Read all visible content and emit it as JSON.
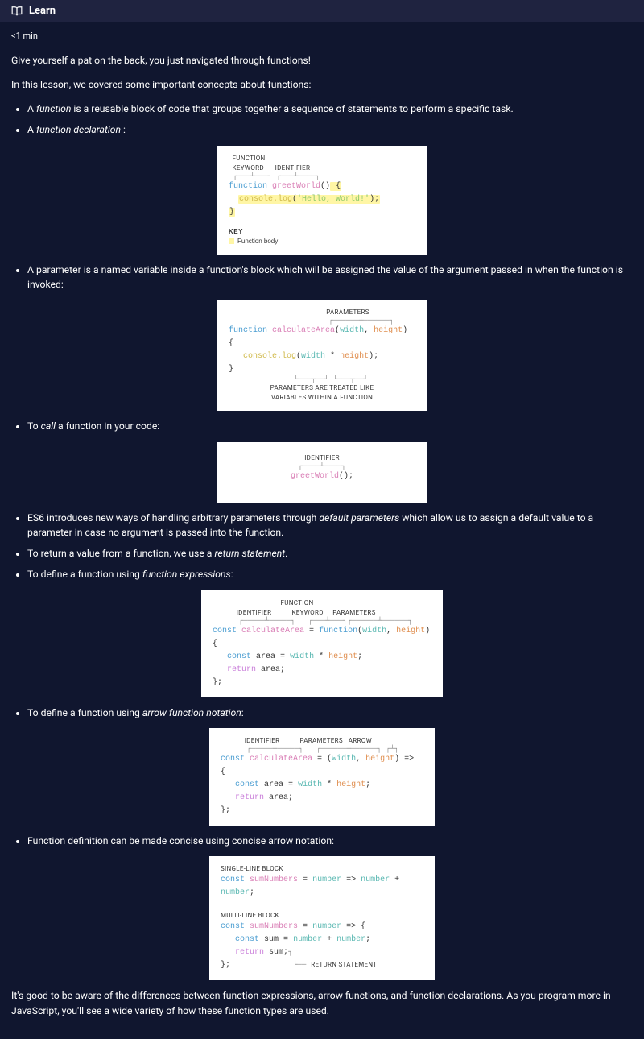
{
  "header": {
    "title": "Learn"
  },
  "readtime": "<1 min",
  "intro_line": "Give yourself a pat on the back, you just navigated through functions!",
  "intro_sub": "In this lesson, we covered some important concepts about functions:",
  "bullets": {
    "b1a": "A ",
    "b1i": "function",
    "b1b": " is a reusable block of code that groups together a sequence of statements to perform a specific task.",
    "b2a": "A ",
    "b2i": "function declaration",
    "b2b": " :",
    "b3": "A parameter is a named variable inside a function's block which will be assigned the value of the argument passed in when the function is invoked:",
    "b4a": "To ",
    "b4i": "call",
    "b4b": " a function in your code:",
    "b5a": "ES6 introduces new ways of handling arbitrary parameters through ",
    "b5i": "default parameters",
    "b5b": " which allow us to assign a default value to a parameter in case no argument is passed into the function.",
    "b6a": "To return a value from a function, we use a ",
    "b6i": "return statement",
    "b6b": ".",
    "b7a": "To define a function using ",
    "b7i": "function expressions",
    "b7b": ":",
    "b8a": "To define a function using ",
    "b8i": "arrow function notation",
    "b8b": ":",
    "b9": "Function definition can be made concise using concise arrow notation:"
  },
  "outro": "It's good to be aware of the differences between function expressions, arrow functions, and function declarations. As you program more in JavaScript, you'll see a wide variety of how these function types are used.",
  "diagram1": {
    "lbl_func": "FUNCTION",
    "lbl_kw": "KEYWORD",
    "lbl_id": "IDENTIFIER",
    "code_kw": "function",
    "code_id": "greetWorld",
    "code_par": "()",
    "code_brace_open": " {",
    "code_log": "console.log",
    "code_paren_open": "(",
    "code_str": "'Hello, World!'",
    "code_paren_close": ")",
    "code_semi": ";",
    "code_brace_close": "}",
    "key_title": "KEY",
    "key_item": "Function body"
  },
  "diagram2": {
    "lbl_params": "PARAMETERS",
    "code_kw": "function",
    "code_id": "calculateArea",
    "code_paren_open": "(",
    "p1": "width",
    "comma": ", ",
    "p2": "height",
    "code_paren_close": ")",
    "brace_open": " {",
    "code_log": "console.log",
    "star": " * ",
    "brace_close": "}",
    "lbl_bottom1": "PARAMETERS ARE TREATED LIKE",
    "lbl_bottom2": "VARIABLES WITHIN A FUNCTION"
  },
  "diagram3": {
    "lbl_id": "IDENTIFIER",
    "code_id": "greetWorld",
    "code_call": "();"
  },
  "diagram4": {
    "lbl_id": "IDENTIFIER",
    "lbl_func": "FUNCTION",
    "lbl_kw": "KEYWORD",
    "lbl_params": "PARAMETERS",
    "code_const": "const",
    "code_id": "calculateArea",
    "code_eq": " = ",
    "code_kw": "function",
    "paren_open": "(",
    "p1": "width",
    "comma": ", ",
    "p2": "height",
    "paren_close": ")",
    "brace_open": " {",
    "line2a": "const",
    "line2b": " area ",
    "line2c": "= ",
    "line2d": "width",
    "star": " * ",
    "line2e": "height",
    "semi": ";",
    "ret": "return",
    "retval": " area",
    "brace_close": "};"
  },
  "diagram5": {
    "lbl_id": "IDENTIFIER",
    "lbl_params": "PARAMETERS",
    "lbl_arrow": "ARROW",
    "code_const": "const",
    "code_id": "calculateArea",
    "code_eq": " = ",
    "paren_open": "(",
    "p1": "width",
    "comma": ", ",
    "p2": "height",
    "paren_close": ")",
    "arrow": " => ",
    "brace_open": "{",
    "line2a": "const",
    "line2b": " area ",
    "line2c": "= ",
    "line2d": "width",
    "star": " * ",
    "line2e": "height",
    "semi": ";",
    "ret": "return",
    "retval": " area",
    "brace_close": "};"
  },
  "diagram6": {
    "lbl_single": "SINGLE-LINE BLOCK",
    "code_const": "const",
    "code_id": "sumNumbers",
    "code_eq": " = ",
    "p1": "number",
    "arrow": " => ",
    "plus": " + ",
    "semi": ";",
    "lbl_multi": "MULTI-LINE BLOCK",
    "brace_open": "{",
    "line2a": "const",
    "line2b": " sum ",
    "line2c": "= ",
    "ret": "return",
    "retval": " sum",
    "lbl_ret": "RETURN STATEMENT",
    "brace_close": "};"
  }
}
